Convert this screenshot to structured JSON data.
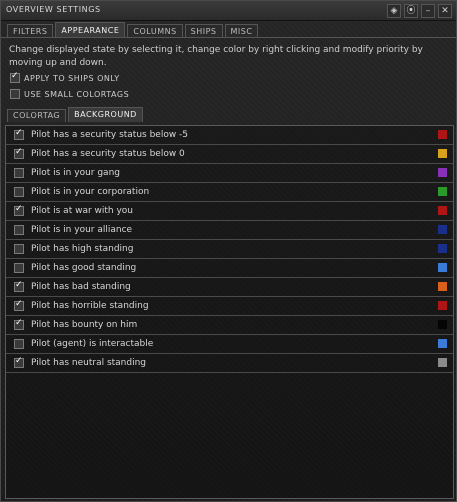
{
  "window": {
    "title": "OVERVIEW SETTINGS"
  },
  "titlebar_buttons": [
    "◈",
    "⦿",
    "–",
    "✕"
  ],
  "tabs": [
    {
      "label": "FILTERS",
      "active": false
    },
    {
      "label": "APPEARANCE",
      "active": true
    },
    {
      "label": "COLUMNS",
      "active": false
    },
    {
      "label": "SHIPS",
      "active": false
    },
    {
      "label": "MISC",
      "active": false
    }
  ],
  "description": "Change displayed state by selecting it, change color by right clicking and modify priority by moving up and down.",
  "options": [
    {
      "label": "APPLY TO SHIPS ONLY",
      "checked": true
    },
    {
      "label": "USE SMALL COLORTAGS",
      "checked": false
    }
  ],
  "subtabs": [
    {
      "label": "COLORTAG",
      "active": false
    },
    {
      "label": "BACKGROUND",
      "active": true
    }
  ],
  "states": [
    {
      "label": "Pilot has a security status below -5",
      "checked": true,
      "color": "#b01515"
    },
    {
      "label": "Pilot has a security status below 0",
      "checked": true,
      "color": "#d8a21a"
    },
    {
      "label": "Pilot is in your gang",
      "checked": false,
      "color": "#8a2fb8"
    },
    {
      "label": "Pilot is in your corporation",
      "checked": false,
      "color": "#2a9a2a"
    },
    {
      "label": "Pilot is at war with you",
      "checked": true,
      "color": "#b01515"
    },
    {
      "label": "Pilot is in your alliance",
      "checked": false,
      "color": "#1a2f8a"
    },
    {
      "label": "Pilot has high standing",
      "checked": false,
      "color": "#1a2f8a"
    },
    {
      "label": "Pilot has good standing",
      "checked": false,
      "color": "#3a7ad8"
    },
    {
      "label": "Pilot has bad standing",
      "checked": true,
      "color": "#d8601a"
    },
    {
      "label": "Pilot has horrible standing",
      "checked": true,
      "color": "#b01515"
    },
    {
      "label": "Pilot has bounty on him",
      "checked": true,
      "color": "#050505"
    },
    {
      "label": "Pilot (agent) is interactable",
      "checked": false,
      "color": "#3a7ad8"
    },
    {
      "label": "Pilot has neutral standing",
      "checked": true,
      "color": "#8a8a8a"
    }
  ]
}
